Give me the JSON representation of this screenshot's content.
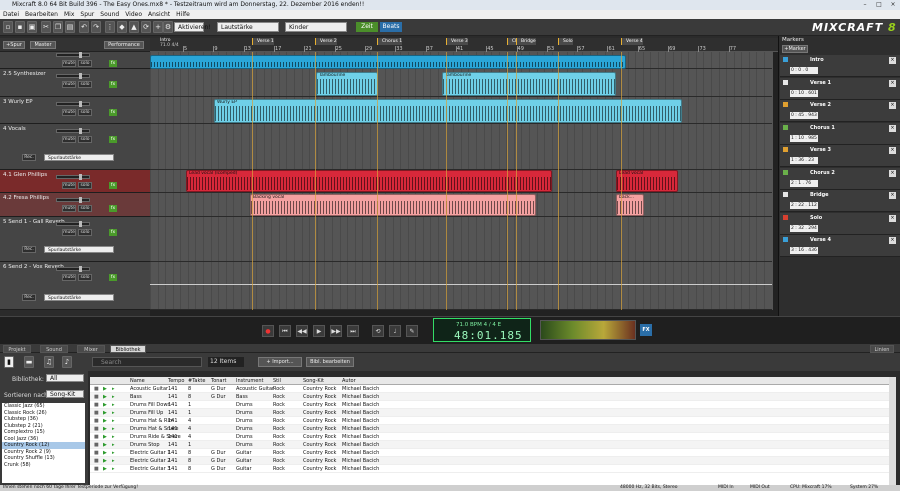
{
  "window": {
    "title": "Mixcraft 8.0 64 Bit Build 396 - The Easy Ones.mx8 * - Testzeitraum wird am Donnerstag, 22. Dezember 2016 enden!!"
  },
  "menu": [
    "Datei",
    "Bearbeiten",
    "Mix",
    "Spur",
    "Sound",
    "Video",
    "Ansicht",
    "Hilfe"
  ],
  "toolbar": {
    "dropdowns": [
      "Aktivieren!",
      "Lautstärke",
      "Kinder"
    ],
    "zeit_label": "Zeit",
    "beats_label": "Beats",
    "logo_main": "MIXCRAFT",
    "logo_ver": "8"
  },
  "trackhead": {
    "add_track": "+Spur",
    "master": "Master",
    "performance": "Performance"
  },
  "ruler": {
    "start_label": "Intro",
    "tempo_readout": "71.0  4/4",
    "numbers": [
      "5",
      "9",
      "13",
      "17",
      "21",
      "25",
      "29",
      "33",
      "37",
      "41",
      "45",
      "49",
      "53",
      "57",
      "61",
      "65",
      "69",
      "73",
      "77"
    ],
    "markers": [
      "Intro",
      "Verse 1",
      "Verse 2",
      "Chorus 1",
      "Verse 3",
      "Chorus 2",
      "Bridge",
      "Solo",
      "Verse 4"
    ]
  },
  "tracks": [
    {
      "name": "",
      "mute": "mute",
      "solo": "solo",
      "fx": "fx"
    },
    {
      "name": "2.5 Synthesizer",
      "mute": "mute",
      "solo": "solo",
      "fx": "fx"
    },
    {
      "name": "3 Wurly EP",
      "mute": "mute",
      "solo": "solo",
      "fx": "fx"
    },
    {
      "name": "4 Vocals",
      "mute": "mute",
      "solo": "solo",
      "fx": "fx",
      "rec": "Rec.",
      "lane": "Spurlautstärke"
    },
    {
      "name": "4.1 Glen Phillips",
      "mute": "mute",
      "solo": "solo",
      "fx": "fx"
    },
    {
      "name": "4.2 Fresa Phillips",
      "mute": "mute",
      "solo": "solo",
      "fx": "fx"
    },
    {
      "name": "5 Send 1 - Gall Reverb",
      "mute": "mute",
      "solo": "solo",
      "fx": "fx",
      "rec": "Rec.",
      "lane": "Spurlautstärke"
    },
    {
      "name": "6 Send 2 - Vox Reverb",
      "mute": "mute",
      "solo": "solo",
      "fx": "fx",
      "rec": "Rec.",
      "lane": "Spurlautstärke"
    }
  ],
  "clips": {
    "tamborine1": "Tambourine",
    "tamborine2": "Tambourine",
    "wurly": "Wurly EP",
    "lead": "Lead vocal (lcomped)",
    "lead2": "Lead vocal",
    "backing": "Backing vocal",
    "backing2": "back..."
  },
  "marker_panel": {
    "title": "Markers",
    "add": "+Marker",
    "items": [
      {
        "name": "Intro",
        "time": "0 : 0 . 0",
        "color": "#3aa0d8"
      },
      {
        "name": "Verse 1",
        "time": "0 : 10 . 601",
        "color": "#e8e8e8"
      },
      {
        "name": "Verse 2",
        "time": "0 : 45 . 943",
        "color": "#e0a030"
      },
      {
        "name": "Chorus 1",
        "time": "1 : 10 . 985",
        "color": "#6ab04a"
      },
      {
        "name": "Verse 3",
        "time": "1 : 36 . 23",
        "color": "#e0a030"
      },
      {
        "name": "Chorus 2",
        "time": "2 : 1 . 76",
        "color": "#6ab04a"
      },
      {
        "name": "Bridge",
        "time": "2 : 22 . 112",
        "color": "#e8e8e8"
      },
      {
        "name": "Solo",
        "time": "2 : 32 . 294",
        "color": "#d84030"
      },
      {
        "name": "Verse 4",
        "time": "3 : 16 . 436",
        "color": "#3aa0d8"
      }
    ]
  },
  "transport": {
    "tempo_line": "71.0 BPM   4 / 4     E",
    "time": "48:01.185",
    "fx": "FX"
  },
  "tabs": [
    "Projekt",
    "Sound",
    "Mixer",
    "Bibliothek"
  ],
  "tab_right": "Linien",
  "library": {
    "search_placeholder": "Search",
    "count": "12 Items",
    "import": "+ Import...",
    "edit": "Bibl. bearbeiten",
    "bib_label": "Bibliothek:",
    "bib_value": "All",
    "sort_label": "Sortieren nach:",
    "sort_value": "Song-Kit",
    "genres": [
      "Classic Jazz (65)",
      "Classic Rock (26)",
      "Clubstep (36)",
      "Clubstep 2 (21)",
      "Complextro (15)",
      "Cool Jazz (36)",
      "Country Rock (12)",
      "Country Rock 2 (9)",
      "Country Shuffle (13)",
      "Crunk (58)"
    ],
    "columns": [
      "Name",
      "Tempo",
      "#Takte",
      "Tonart",
      "Instrument",
      "Stil",
      "Song-Kit",
      "Autor"
    ],
    "rows": [
      [
        "Acoustic Guitar",
        "141",
        "8",
        "G Dur",
        "Acoustic Guitar",
        "Rock",
        "Country Rock",
        "Michael Bacich"
      ],
      [
        "Bass",
        "141",
        "8",
        "G Dur",
        "Bass",
        "Rock",
        "Country Rock",
        "Michael Bacich"
      ],
      [
        "Drums Fill Down",
        "141",
        "1",
        "",
        "Drums",
        "Rock",
        "Country Rock",
        "Michael Bacich"
      ],
      [
        "Drums Fill Up",
        "141",
        "1",
        "",
        "Drums",
        "Rock",
        "Country Rock",
        "Michael Bacich"
      ],
      [
        "Drums Hat & Rim",
        "141",
        "4",
        "",
        "Drums",
        "Rock",
        "Country Rock",
        "Michael Bacich"
      ],
      [
        "Drums Hat & Snare",
        "141",
        "4",
        "",
        "Drums",
        "Rock",
        "Country Rock",
        "Michael Bacich"
      ],
      [
        "Drums Ride & Snare",
        "141",
        "4",
        "",
        "Drums",
        "Rock",
        "Country Rock",
        "Michael Bacich"
      ],
      [
        "Drums Stop",
        "141",
        "1",
        "",
        "Drums",
        "Rock",
        "Country Rock",
        "Michael Bacich"
      ],
      [
        "Electric Guitar 1",
        "141",
        "8",
        "G Dur",
        "Guitar",
        "Rock",
        "Country Rock",
        "Michael Bacich"
      ],
      [
        "Electric Guitar 2",
        "141",
        "8",
        "G Dur",
        "Guitar",
        "Rock",
        "Country Rock",
        "Michael Bacich"
      ],
      [
        "Electric Guitar 3",
        "141",
        "8",
        "G Dur",
        "Guitar",
        "Rock",
        "Country Rock",
        "Michael Bacich"
      ]
    ]
  },
  "status": {
    "left": "Ihnen stehen noch 60 Tage Ihrer Testperiode zur Verfügung!",
    "rate": "48000 Hz, 32 Bits, Stereo",
    "midi_in": "MIDI In",
    "midi_out": "MIDI Out",
    "cpu": "CPU: Mixcraft 17%",
    "system": "System 27%"
  }
}
